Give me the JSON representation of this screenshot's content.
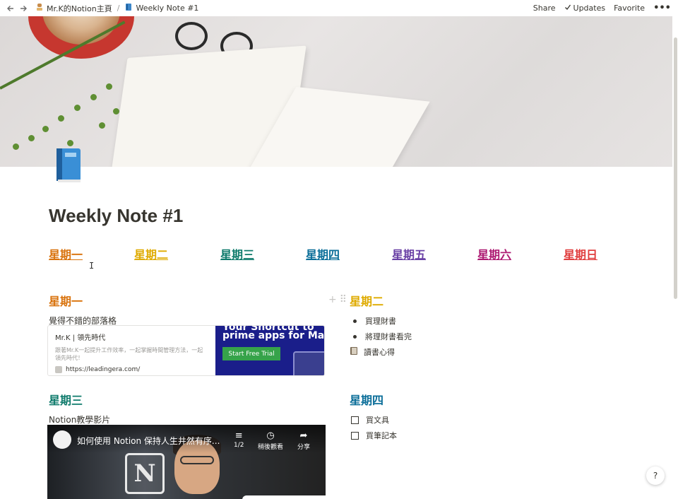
{
  "topbar": {
    "breadcrumbs": [
      {
        "label": "Mr.K的Notion主頁",
        "icon": "person-icon"
      },
      {
        "label": "Weekly Note #1",
        "icon": "book-icon"
      }
    ],
    "separator": "/",
    "share": "Share",
    "updates": "Updates",
    "favorite": "Favorite",
    "more": "•••"
  },
  "page": {
    "title": "Weekly Note #1"
  },
  "days": [
    {
      "label": "星期一",
      "color": "#d9730d"
    },
    {
      "label": "星期二",
      "color": "#dfab01"
    },
    {
      "label": "星期三",
      "color": "#0f7b6c"
    },
    {
      "label": "星期四",
      "color": "#0b6e99"
    },
    {
      "label": "星期五",
      "color": "#6940a5"
    },
    {
      "label": "星期六",
      "color": "#ad1a72"
    },
    {
      "label": "星期日",
      "color": "#e03e3e"
    }
  ],
  "monday": {
    "heading": "星期一",
    "color": "#d9730d",
    "subtitle": "覺得不錯的部落格",
    "bookmark": {
      "title": "Mr.K | 領先時代",
      "description": "跟著Mr.K一起提升工作效率，一起掌握時間管理方法，一起領先時代！",
      "url": "https://leadingera.com/",
      "ad_line1": "Your Shortcut to",
      "ad_line2": "prime apps for Mac",
      "ad_cta": "Start Free Trial"
    }
  },
  "tuesday": {
    "heading": "星期二",
    "color": "#dfab01",
    "items": [
      "買理財書",
      "將理財書看完"
    ],
    "page_link": "讀書心得"
  },
  "wednesday": {
    "heading": "星期三",
    "color": "#0f7b6c",
    "subtitle": "Notion教學影片",
    "video": {
      "title": "如何使用 Notion 保持人生井然有序...",
      "playlist": "1/2",
      "watch_later": "稍後觀看",
      "share": "分享"
    }
  },
  "thursday": {
    "heading": "星期四",
    "color": "#0b6e99",
    "todos": [
      "買文具",
      "買筆記本"
    ]
  },
  "help": "?"
}
